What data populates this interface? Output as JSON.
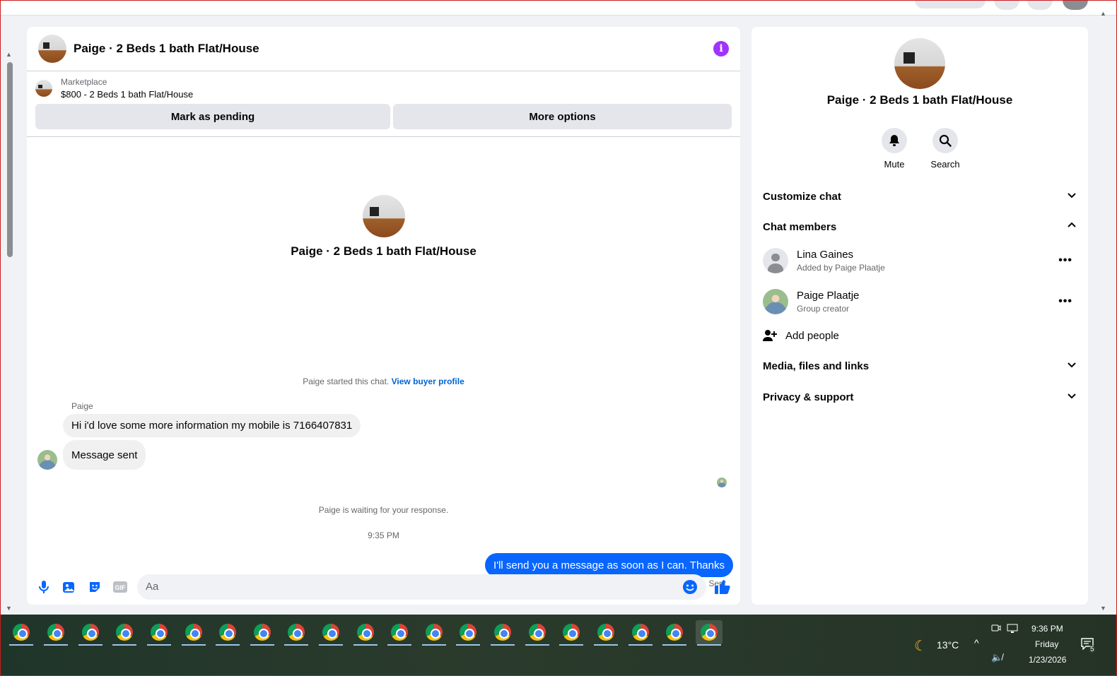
{
  "conversation": {
    "title": "Paige · 2 Beds 1 bath Flat/House"
  },
  "marketplace": {
    "label": "Marketplace",
    "listing": "$800 - 2 Beds 1 bath Flat/House",
    "mark_pending_label": "Mark as pending",
    "more_options_label": "More options"
  },
  "messages": {
    "intro_name": "Paige · 2 Beds 1 bath Flat/House",
    "started_text": "Paige started this chat.",
    "view_buyer_link": "View buyer profile",
    "sender_name": "Paige",
    "incoming": [
      "Hi i'd love some more information my mobile is 7166407831",
      "Message sent"
    ],
    "waiting_text": "Paige is waiting for your response.",
    "timestamp": "9:35 PM",
    "outgoing": "I'll send you a message as soon as I can. Thanks",
    "status": "Sent"
  },
  "composer": {
    "placeholder": "Aa"
  },
  "sidebar": {
    "name": "Paige · 2 Beds 1 bath Flat/House",
    "mute_label": "Mute",
    "search_label": "Search",
    "customize_chat": "Customize chat",
    "chat_members": "Chat members",
    "members": [
      {
        "name": "Lina Gaines",
        "sub": "Added by Paige Plaatje"
      },
      {
        "name": "Paige Plaatje",
        "sub": "Group creator"
      }
    ],
    "add_people": "Add people",
    "media_files_links": "Media, files and links",
    "privacy_support": "Privacy & support"
  },
  "taskbar": {
    "weather_temp": "13°C",
    "time": "9:36 PM",
    "day": "Friday",
    "date": "1/23/2026",
    "notification_count": "5"
  },
  "colors": {
    "accent": "#0866ff",
    "info": "#a033ff",
    "link": "#0064d1"
  }
}
